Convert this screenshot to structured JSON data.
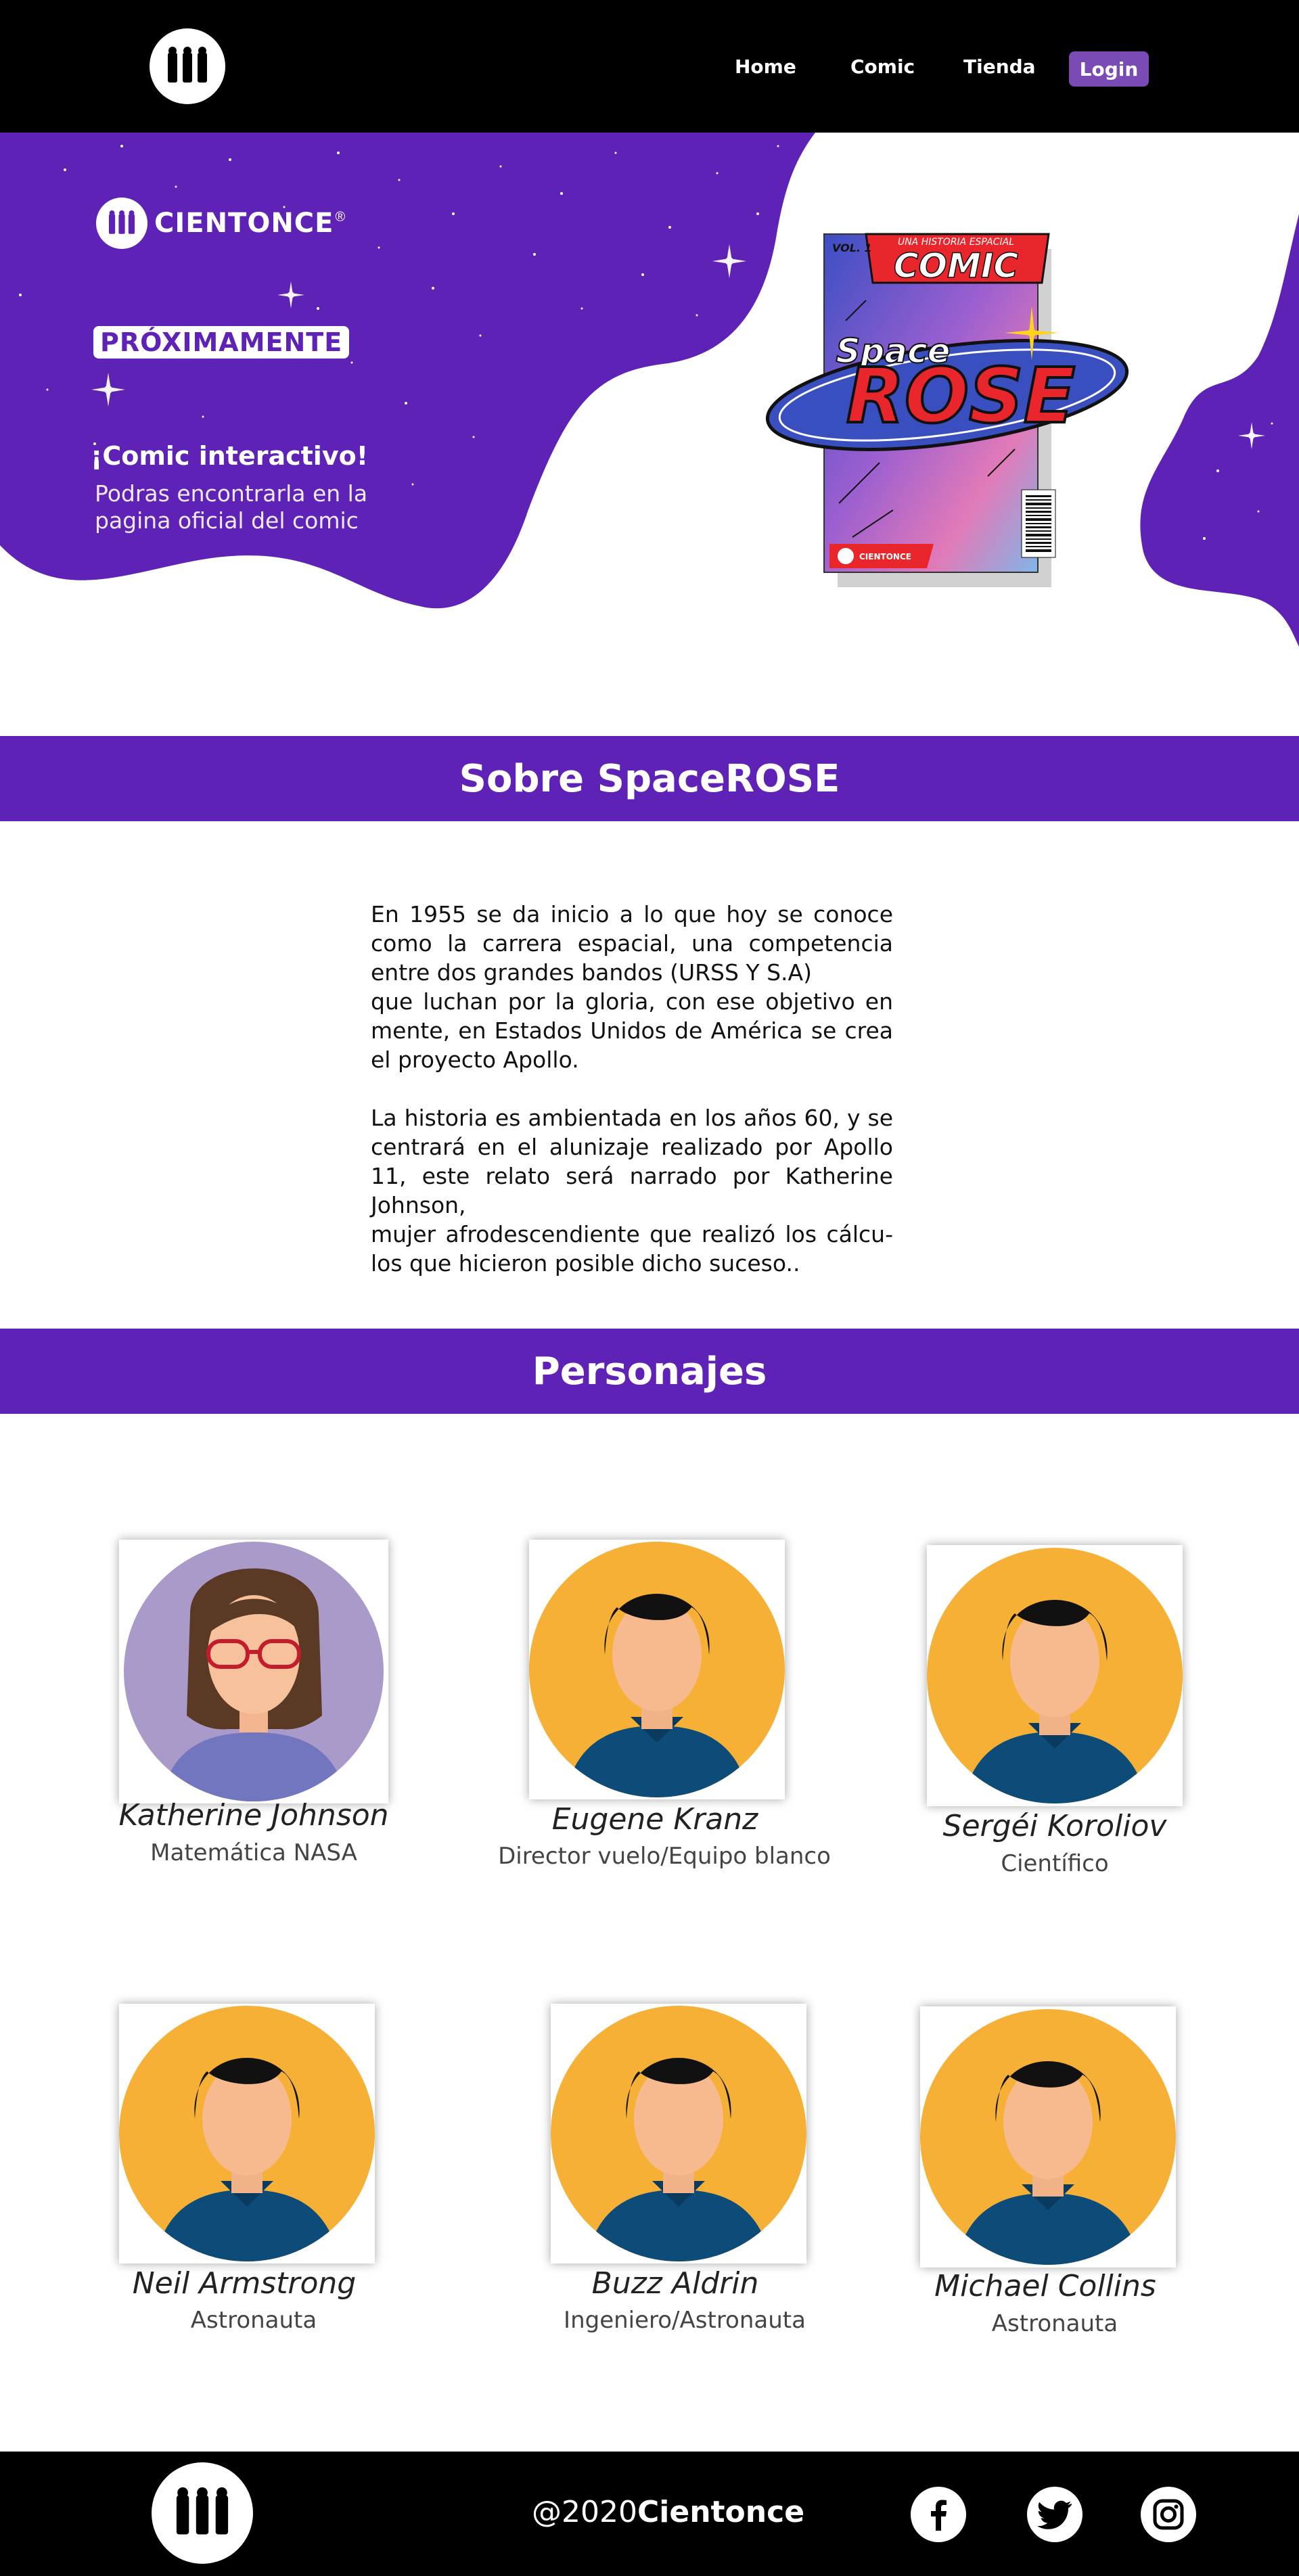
{
  "header": {
    "nav": [
      "Home",
      "Comic",
      "Tienda"
    ],
    "login_label": "Login"
  },
  "hero": {
    "brand_name": "CIENTONCE",
    "brand_mark": "®",
    "badge": "PRÓXIMAMENTE",
    "heading": "¡Comic interactivo!",
    "description": "Podras encontrarla en la pagina oficial del comic"
  },
  "comic_cover": {
    "tagline": "UNA HISTORIA ESPACIAL",
    "series": "COMIC",
    "volume": "VOL. 1",
    "title_top": "Space",
    "title_main": "ROSE",
    "publisher": "CIENTONCE"
  },
  "about": {
    "title": "Sobre SpaceROSE",
    "paragraph1": " En 1955 se da inicio a lo que hoy se conoce como la carrera espacial, una competencia entre dos grandes bandos (URSS Y S.A)\nque luchan por la gloria, con ese objetivo en mente, en Estados Unidos de América se crea el proyecto Apollo.",
    "paragraph2": "La historia es ambientada en los años 60, y se centrará en el alunizaje realizado por Apollo 11, este relato será narrado por Katherine Johnson,\n mujer afrodescendiente que realizó los cálcu-los que hicieron posible dicho suceso.."
  },
  "characters": {
    "title": "Personajes",
    "items": [
      {
        "name": "Katherine Johnson",
        "role": "Matemática NASA",
        "avatar": "woman-avatar-icon",
        "bg_color": "#a99ac9"
      },
      {
        "name": "Eugene Kranz",
        "role": "Director vuelo/Equipo blanco",
        "avatar": "man-avatar-icon",
        "bg_color": "#f5b035"
      },
      {
        "name": "Sergéi Koroliov",
        "role": "Científico",
        "avatar": "man-avatar-icon",
        "bg_color": "#f5b035"
      },
      {
        "name": "Neil Armstrong",
        "role": "Astronauta",
        "avatar": "man-avatar-icon",
        "bg_color": "#f5b035"
      },
      {
        "name": "Buzz Aldrin",
        "role": "Ingeniero/Astronauta",
        "avatar": "man-avatar-icon",
        "bg_color": "#f5b035"
      },
      {
        "name": "Michael Collins",
        "role": "Astronauta",
        "avatar": "man-avatar-icon",
        "bg_color": "#f5b035"
      }
    ]
  },
  "footer": {
    "copyright_prefix": "@2020",
    "copyright_brand": "Cientonce",
    "social": [
      "facebook-icon",
      "twitter-icon",
      "instagram-icon"
    ]
  },
  "colors": {
    "purple": "#5e22b6",
    "black": "#000000",
    "login_bg": "#7a4bb5"
  }
}
